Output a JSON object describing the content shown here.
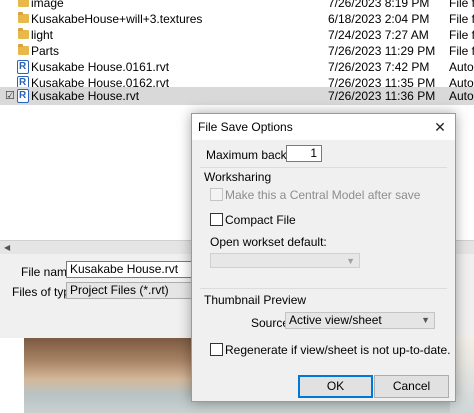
{
  "file_list": {
    "rows": [
      {
        "name": "image",
        "date": "7/26/2023 8:19 PM",
        "type": "File fo",
        "icon": "folder-icon"
      },
      {
        "name": "KusakabeHouse+will+3.textures",
        "date": "6/18/2023 2:04 PM",
        "type": "File fo",
        "icon": "folder-icon"
      },
      {
        "name": "light",
        "date": "7/24/2023 7:27 AM",
        "type": "File fo",
        "icon": "folder-icon"
      },
      {
        "name": "Parts",
        "date": "7/26/2023 11:29 PM",
        "type": "File fo",
        "icon": "folder-icon"
      },
      {
        "name": "Kusakabe House.0161.rvt",
        "date": "7/26/2023 7:42 PM",
        "type": "Autoc",
        "icon": "revit-file-icon"
      },
      {
        "name": "Kusakabe House.0162.rvt",
        "date": "7/26/2023 11:35 PM",
        "type": "Autoc",
        "icon": "revit-file-icon"
      },
      {
        "name": "Kusakabe House.rvt",
        "date": "7/26/2023 11:36 PM",
        "type": "Autoc",
        "icon": "revit-file-icon",
        "selected": true
      }
    ],
    "revit_icon_letter": "R",
    "check_glyph": "☑"
  },
  "save_form": {
    "file_name_label": "File name:",
    "file_name_value": "Kusakabe House.rvt",
    "file_type_label": "Files of type:",
    "file_type_value": "Project Files  (*.rvt)"
  },
  "dialog": {
    "title": "File Save Options",
    "close_glyph": "✕",
    "max_backups_label": "Maximum backups:",
    "max_backups_value": "1",
    "worksharing_heading": "Worksharing",
    "central_model_label": "Make this a Central Model after save",
    "compact_file_label": "Compact File",
    "open_workset_label": "Open workset default:",
    "thumbnail_heading": "Thumbnail Preview",
    "source_label": "Source:",
    "source_value": "Active view/sheet",
    "regenerate_label": "Regenerate if view/sheet is not up-to-date.",
    "ok_label": "OK",
    "cancel_label": "Cancel"
  },
  "colors": {
    "accent": "#0078d7",
    "selection": "#d9d9d9",
    "dialog_bg": "#f0f0f0"
  }
}
